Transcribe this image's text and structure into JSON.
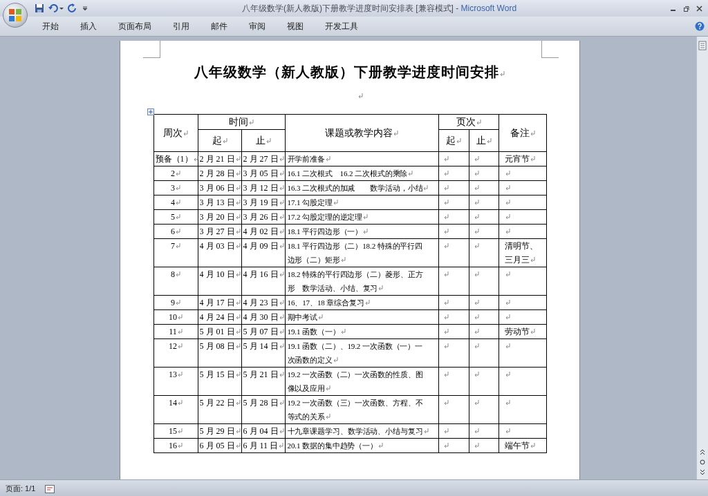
{
  "window": {
    "title": "八年级数学(新人教版)下册教学进度时间安排表 [兼容模式]",
    "separator": "-",
    "app_name": "Microsoft Word"
  },
  "ribbon_tabs": [
    {
      "label": "开始",
      "selected": false
    },
    {
      "label": "插入",
      "selected": false
    },
    {
      "label": "页面布局",
      "selected": false
    },
    {
      "label": "引用",
      "selected": false
    },
    {
      "label": "邮件",
      "selected": false
    },
    {
      "label": "审阅",
      "selected": false
    },
    {
      "label": "视图",
      "selected": false
    },
    {
      "label": "开发工具",
      "selected": false
    }
  ],
  "document": {
    "title": "八年级数学（新人教版）下册教学进度时间安排",
    "table": {
      "headers": {
        "week": "周次",
        "time": "时间",
        "time_start": "起",
        "time_end": "止",
        "content": "课题或教学内容",
        "pages": "页次",
        "page_start": "起",
        "page_end": "止",
        "note": "备注"
      },
      "rows": [
        {
          "week": "预备（1）",
          "start": "2 月 21 日",
          "end": "2 月 27 日",
          "content": "开学前准备",
          "note": "元宵节"
        },
        {
          "week": "2",
          "start": "2 月 28 日",
          "end": "3 月 05 日",
          "content": "16.1 二次根式　16.2 二次根式的乘除",
          "note": ""
        },
        {
          "week": "3",
          "start": "3 月 06 日",
          "end": "3 月 12 日",
          "content": "16.3 二次根式的加减　　数学活动，小结",
          "note": ""
        },
        {
          "week": "4",
          "start": "3 月 13 日",
          "end": "3 月 19 日",
          "content": "17.1 勾股定理",
          "note": ""
        },
        {
          "week": "5",
          "start": "3 月 20 日",
          "end": "3 月 26 日",
          "content": "17.2 勾股定理的逆定理",
          "note": ""
        },
        {
          "week": "6",
          "start": "3 月 27 日",
          "end": "4 月 02 日",
          "content": "18.1 平行四边形（一）",
          "note": ""
        },
        {
          "week": "7",
          "start": "4 月 03 日",
          "end": "4 月 09 日",
          "content": "18.1 平行四边形（二）18.2 特殊的平行四边形（二）矩形",
          "note": "清明节、三月三"
        },
        {
          "week": "8",
          "start": "4 月 10 日",
          "end": "4 月 16 日",
          "content": "18.2 特殊的平行四边形（二）菱形、正方形　数学活动、小结、复习",
          "note": ""
        },
        {
          "week": "9",
          "start": "4 月 17 日",
          "end": "4 月 23 日",
          "content": "16、17、18 章综合复习",
          "note": ""
        },
        {
          "week": "10",
          "start": "4 月 24 日",
          "end": "4 月 30 日",
          "content": "期中考试",
          "note": ""
        },
        {
          "week": "11",
          "start": "5 月 01 日",
          "end": "5 月 07 日",
          "content": "19.1 函数（一）",
          "note": "劳动节"
        },
        {
          "week": "12",
          "start": "5 月 08 日",
          "end": "5 月 14 日",
          "content": "19.1 函数（二）、19.2 一次函数（一）一次函数的定义",
          "note": ""
        },
        {
          "week": "13",
          "start": "5 月 15 日",
          "end": "5 月 21 日",
          "content": "19.2 一次函数（二）一次函数的性质、图像以及应用",
          "note": ""
        },
        {
          "week": "14",
          "start": "5 月 22 日",
          "end": "5 月 28 日",
          "content": "19.2 一次函数（三）一次函数、方程、不等式的关系",
          "note": ""
        },
        {
          "week": "15",
          "start": "5 月 29 日",
          "end": "6 月 04 日",
          "content": "十九章课题学习、数学活动、小结与复习",
          "note": ""
        },
        {
          "week": "16",
          "start": "6 月 05 日",
          "end": "6 月 11 日",
          "content": "20.1 数据的集中趋势（一）",
          "note": "端午节"
        }
      ]
    }
  },
  "status_bar": {
    "page": "页面: 1/1"
  }
}
